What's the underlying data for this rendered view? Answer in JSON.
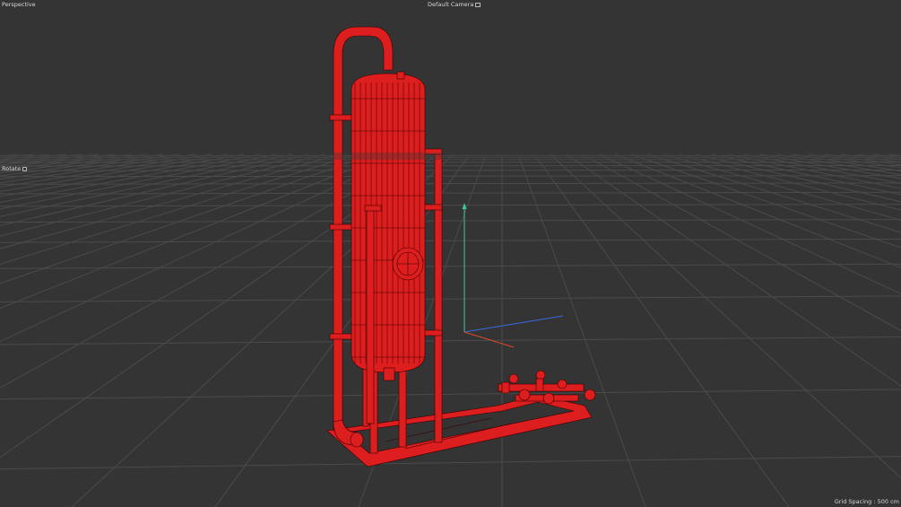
{
  "viewport": {
    "view_name": "Perspective",
    "camera_label": "Default Camera",
    "camera_icon": "camera-icon",
    "tool_label": "Rotate",
    "tool_icon": "rotate-tool-icon",
    "grid_spacing": "Grid Spacing : 500 cm"
  },
  "colors": {
    "background": "#343434",
    "grid": "#4a4a4a",
    "model": "#e02020",
    "wire": "#3a0000",
    "axis_x": "#e04a2a",
    "axis_y": "#3cc8a0",
    "axis_z": "#3a6ae0"
  }
}
